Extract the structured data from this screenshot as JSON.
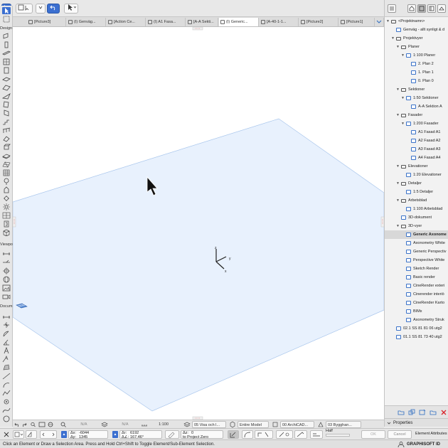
{
  "toolbar": {
    "arrow_tool_icon": "arrow-pointer-icon",
    "undo_icon": "undo-icon"
  },
  "tabs": [
    {
      "label": "[Picture3]"
    },
    {
      "label": "(I) Genväg..."
    },
    {
      "label": "[Action Ce..."
    },
    {
      "label": "(I) A1 Fasa..."
    },
    {
      "label": "[A-A Sekti..."
    },
    {
      "label": "(I) Generic..."
    },
    {
      "label": "[A-40-1-1..."
    },
    {
      "label": "[Picture2]"
    },
    {
      "label": "[Picture1]"
    }
  ],
  "toolbox": {
    "design_label": "Design",
    "viewpoint_label": "Viewpo",
    "document_label": "Docum"
  },
  "canvas": {
    "axis_x": "x",
    "axis_y": "y",
    "axis_z": "z",
    "plane_color": "#e8f1fd",
    "plane_stroke": "#a9c6ec"
  },
  "navigator": {
    "items": [
      {
        "label": "<Projektnamn>",
        "level": 0,
        "arrow": "▼"
      },
      {
        "label": "Genväg - allt synligt & d",
        "level": 1,
        "arrow": ""
      },
      {
        "label": "Projektvyer",
        "level": 1,
        "arrow": "▼"
      },
      {
        "label": "Planer",
        "level": 2,
        "arrow": "▼"
      },
      {
        "label": "1:100 Planer",
        "level": 3,
        "arrow": "▼"
      },
      {
        "label": "2. Plan 2",
        "level": 4,
        "arrow": ""
      },
      {
        "label": "1. Plan 1",
        "level": 4,
        "arrow": ""
      },
      {
        "label": "0. Plan 0",
        "level": 4,
        "arrow": ""
      },
      {
        "label": "Sektioner",
        "level": 2,
        "arrow": "▼"
      },
      {
        "label": "1:50 Sektioner",
        "level": 3,
        "arrow": "▼"
      },
      {
        "label": "A-A Sektion A",
        "level": 4,
        "arrow": ""
      },
      {
        "label": "Fasader",
        "level": 2,
        "arrow": "▼"
      },
      {
        "label": "1:200 Fasader",
        "level": 3,
        "arrow": "▼"
      },
      {
        "label": "A1 Fasad A1",
        "level": 4,
        "arrow": ""
      },
      {
        "label": "A2 Fasad A2",
        "level": 4,
        "arrow": ""
      },
      {
        "label": "A3 Fasad A3",
        "level": 4,
        "arrow": ""
      },
      {
        "label": "A4 Fasad A4",
        "level": 4,
        "arrow": ""
      },
      {
        "label": "Elevationer",
        "level": 2,
        "arrow": "▼"
      },
      {
        "label": "1:20 Elevationer",
        "level": 3,
        "arrow": ""
      },
      {
        "label": "Detaljer",
        "level": 2,
        "arrow": "▼"
      },
      {
        "label": "1:5 Detaljer",
        "level": 3,
        "arrow": ""
      },
      {
        "label": "Arbetsblad",
        "level": 2,
        "arrow": "▼"
      },
      {
        "label": "1:100 Arbetsblad",
        "level": 3,
        "arrow": ""
      },
      {
        "label": "3D-dokument",
        "level": 2,
        "arrow": ""
      },
      {
        "label": "3D-vyer",
        "level": 2,
        "arrow": "▼"
      },
      {
        "label": "Generic Axonome",
        "level": 3,
        "arrow": "",
        "selected": true
      },
      {
        "label": "Axonometry White",
        "level": 3,
        "arrow": ""
      },
      {
        "label": "Generic Perspectiv",
        "level": 3,
        "arrow": ""
      },
      {
        "label": "Perspective White",
        "level": 3,
        "arrow": ""
      },
      {
        "label": "Sketch Render",
        "level": 3,
        "arrow": ""
      },
      {
        "label": "Basic render",
        "level": 3,
        "arrow": ""
      },
      {
        "label": "CineRender exteri",
        "level": 3,
        "arrow": ""
      },
      {
        "label": "Cinerender interiö",
        "level": 3,
        "arrow": ""
      },
      {
        "label": "CineRender Karto",
        "level": 3,
        "arrow": ""
      },
      {
        "label": "BIMx",
        "level": 3,
        "arrow": ""
      },
      {
        "label": "Axonometry Struk",
        "level": 3,
        "arrow": ""
      },
      {
        "label": "02.1 SS 81 81 06 utg2",
        "level": 1,
        "arrow": ""
      },
      {
        "label": "01.1 SS 81 73 40 utg2",
        "level": 1,
        "arrow": ""
      }
    ],
    "properties_label": "Properties"
  },
  "quick_options": {
    "na1": "N/A",
    "na2": "N/A",
    "scale": "1:100",
    "layer_combo": "05 Visa och l...",
    "model_view": "Entire Model",
    "mvo": "00 ArchiCAD...",
    "renovation": "03 Bygghan..."
  },
  "tracker": {
    "dx_label": "Δx:",
    "dx": "-6044",
    "dy_label": "Δy:",
    "dy": "1345",
    "dr_label": "Δr:",
    "dr": "6192",
    "da_label": "Δ∠:",
    "da": "167,46°",
    "z_label": "Δz:",
    "z": "0",
    "z_ref": "to Project Zero",
    "half": "Half",
    "ok": "OK",
    "cancel": "Cancel",
    "element_attributes": "Element Attributes"
  },
  "status": {
    "message": "Click an Element or Draw a Selection Area. Press and Hold Ctrl+Shift to Toggle Element/Sub-Element Selection.",
    "brand": "GRAPHISOFT ID"
  }
}
